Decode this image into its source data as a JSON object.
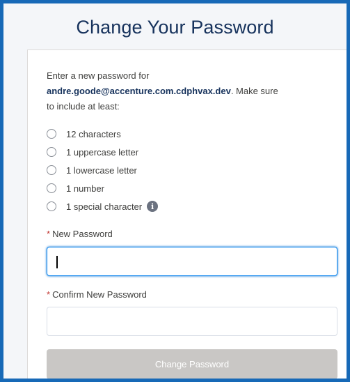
{
  "header": {
    "title": "Change Your Password"
  },
  "intro": {
    "line1": "Enter a new password for",
    "email": "andre.goode@accenture.com.cdphvax.dev",
    "line2_suffix": ". Make sure",
    "line3": "to include at least:"
  },
  "requirements": [
    {
      "label": "12 characters"
    },
    {
      "label": "1 uppercase letter"
    },
    {
      "label": "1 lowercase letter"
    },
    {
      "label": "1 number"
    },
    {
      "label": "1 special character"
    }
  ],
  "new_password": {
    "required_mark": "*",
    "label": "New Password",
    "value": ""
  },
  "confirm_password": {
    "required_mark": "*",
    "label": "Confirm New Password",
    "value": ""
  },
  "submit": {
    "label": "Change Password"
  },
  "colors": {
    "frame_border": "#1769b7",
    "title": "#16325c",
    "required": "#c23934",
    "focus": "#1589ee",
    "button_disabled": "#c9c7c5"
  },
  "icons": {
    "info": "info-icon"
  }
}
